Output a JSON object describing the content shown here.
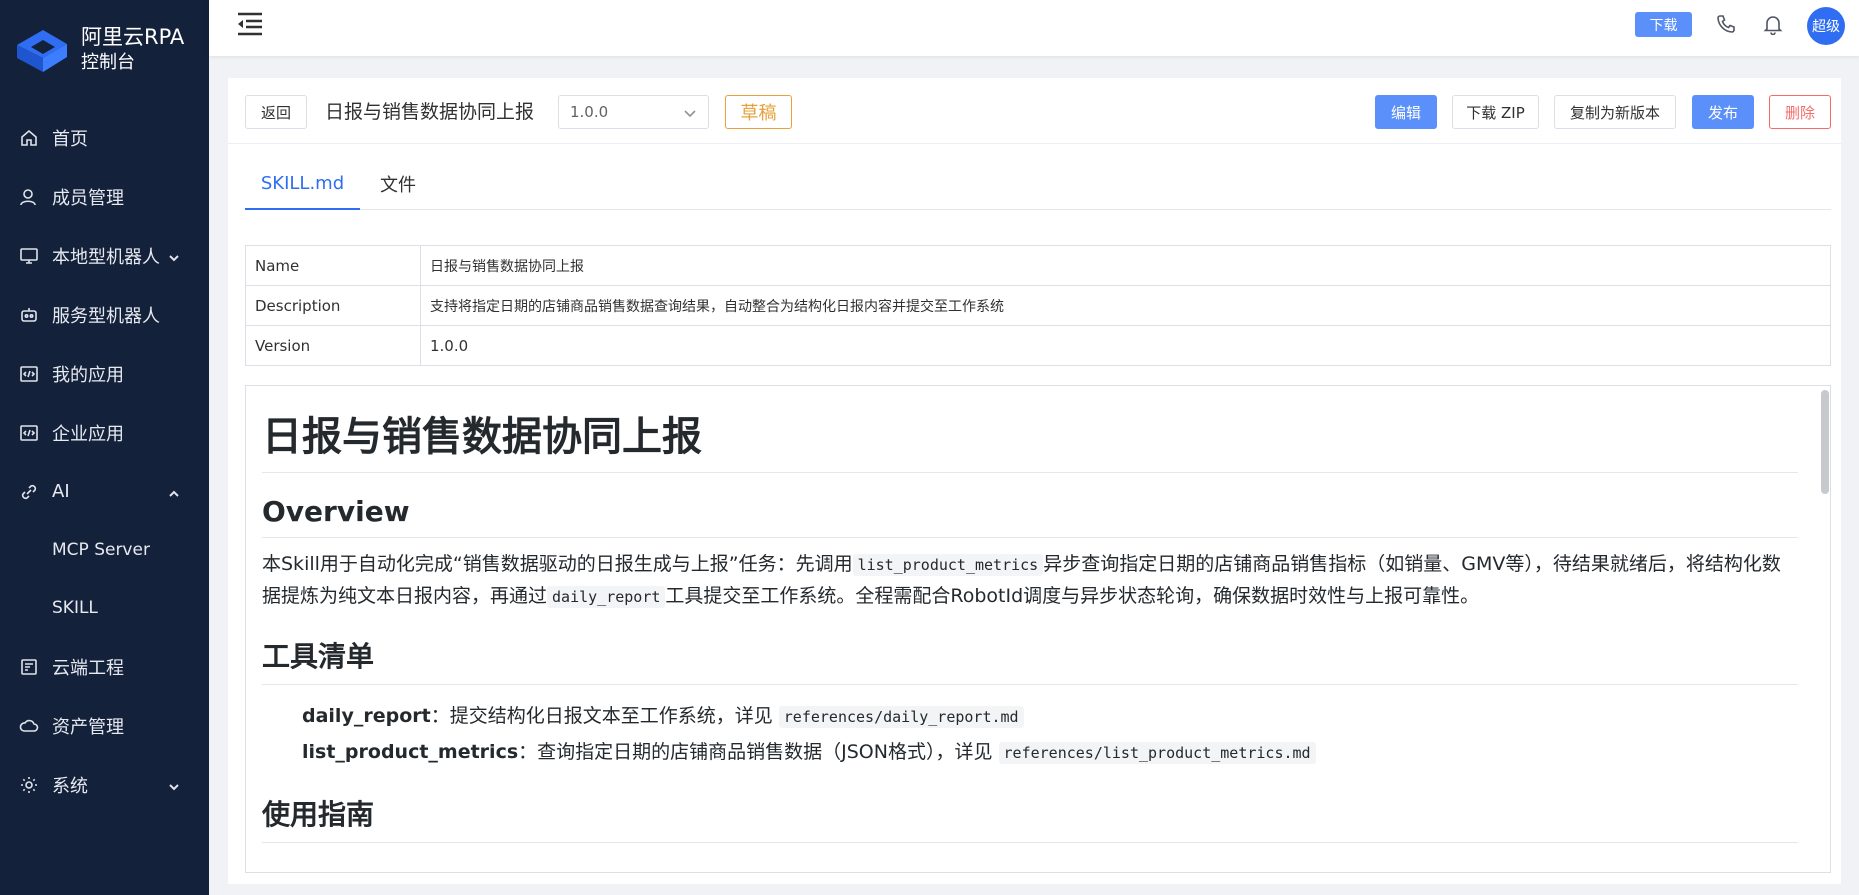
{
  "brand": {
    "title": "阿里云RPA",
    "subtitle": "控制台"
  },
  "sidebar": {
    "items": [
      {
        "label": "首页",
        "icon": "home-icon"
      },
      {
        "label": "成员管理",
        "icon": "user-icon"
      },
      {
        "label": "本地型机器人",
        "icon": "monitor-icon",
        "expand": "down"
      },
      {
        "label": "服务型机器人",
        "icon": "robot-icon"
      },
      {
        "label": "我的应用",
        "icon": "code-icon"
      },
      {
        "label": "企业应用",
        "icon": "code-icon"
      },
      {
        "label": "AI",
        "icon": "link-icon",
        "expand": "up"
      },
      {
        "label": "MCP Server",
        "sub": true
      },
      {
        "label": "SKILL",
        "sub": true
      },
      {
        "label": "云端工程",
        "icon": "cloud-project-icon"
      },
      {
        "label": "资产管理",
        "icon": "cloud-icon"
      },
      {
        "label": "系统",
        "icon": "gear-icon",
        "expand": "down"
      }
    ]
  },
  "header": {
    "download_label": "下载",
    "avatar_text": "超级"
  },
  "toolbar": {
    "back_label": "返回",
    "title": "日报与销售数据协同上报",
    "version_value": "1.0.0",
    "draft_label": "草稿",
    "edit_label": "编辑",
    "download_zip_label": "下载 ZIP",
    "copy_version_label": "复制为新版本",
    "publish_label": "发布",
    "delete_label": "删除"
  },
  "tabs": [
    {
      "label": "SKILL.md",
      "active": true
    },
    {
      "label": "文件",
      "active": false
    }
  ],
  "meta": [
    {
      "key": "Name",
      "value": "日报与销售数据协同上报"
    },
    {
      "key": "Description",
      "value": "支持将指定日期的店铺商品销售数据查询结果，自动整合为结构化日报内容并提交至工作系统"
    },
    {
      "key": "Version",
      "value": "1.0.0"
    }
  ],
  "doc": {
    "h1": "日报与销售数据协同上报",
    "overview_heading": "Overview",
    "overview_p1_a": "本Skill用于自动化完成“销售数据驱动的日报生成与上报”任务：先调用",
    "overview_code1": "list_product_metrics",
    "overview_p1_b": "异步查询指定日期的店铺商品销售指标（如销量、GMV等），待结果就绪后，将结构化数据提炼为纯文本日报内容，再通过",
    "overview_code2": "daily_report",
    "overview_p1_c": "工具提交至工作系统。全程需配合RobotId调度与异步状态轮询，确保数据时效性与上报可靠性。",
    "tools_heading": "工具清单",
    "tools": [
      {
        "name": "daily_report",
        "desc": "：提交结构化日报文本至工作系统，详见",
        "ref": "references/daily_report.md"
      },
      {
        "name": "list_product_metrics",
        "desc": "：查询指定日期的店铺商品销售数据（JSON格式），详见",
        "ref": "references/list_product_metrics.md"
      }
    ],
    "guide_heading": "使用指南"
  },
  "colors": {
    "sidebar_bg": "#14213b",
    "primary": "#5b8ff9",
    "danger": "#f56c6c",
    "warning": "#e6a23c",
    "tab_active": "#2f6ef2"
  }
}
